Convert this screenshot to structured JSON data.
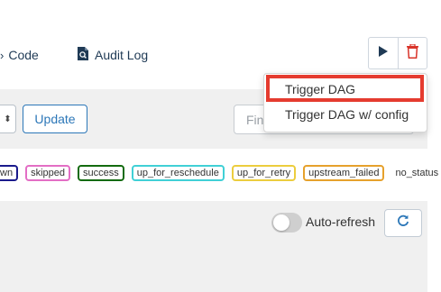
{
  "nav": {
    "code_fragment": "",
    "code_label": "Code",
    "audit_label": "Audit Log"
  },
  "controls": {
    "update_label": "Update",
    "find_placeholder": "Find"
  },
  "legend": [
    {
      "label": "wn",
      "color": "#1a1a8c"
    },
    {
      "label": "skipped",
      "color": "#e36ec5"
    },
    {
      "label": "success",
      "color": "#136b0f"
    },
    {
      "label": "up_for_reschedule",
      "color": "#40d0d6"
    },
    {
      "label": "up_for_retry",
      "color": "#eccd3e"
    },
    {
      "label": "upstream_failed",
      "color": "#e6a12c"
    },
    {
      "label": "no_status",
      "color": ""
    }
  ],
  "refresh": {
    "auto_label": "Auto-refresh"
  },
  "dropdown": {
    "items": [
      "Trigger DAG",
      "Trigger DAG w/ config"
    ]
  },
  "colors": {
    "accent": "#2c77b8",
    "nav_text": "#1f3a55",
    "play": "#1f3a55",
    "delete": "#d9342a",
    "highlight": "#e53b2f"
  }
}
